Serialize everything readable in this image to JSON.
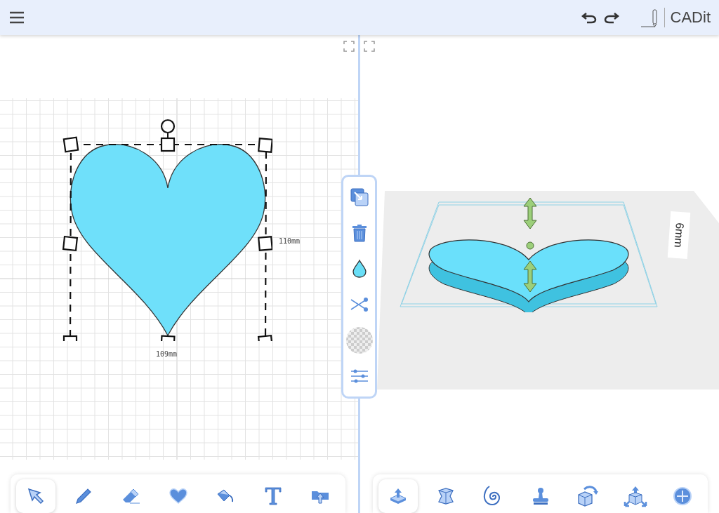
{
  "header": {
    "app_name": "CADit"
  },
  "sketch": {
    "width_label": "109mm",
    "height_label": "110mm"
  },
  "sketch_tools": [
    {
      "kind": "select",
      "selected": true
    },
    {
      "kind": "pencil",
      "selected": false
    },
    {
      "kind": "eraser",
      "selected": false
    },
    {
      "kind": "heart",
      "selected": false
    },
    {
      "kind": "fill",
      "selected": false
    },
    {
      "kind": "text",
      "selected": false
    },
    {
      "kind": "import",
      "selected": false
    }
  ],
  "side_tools": [
    {
      "kind": "duplicate"
    },
    {
      "kind": "delete"
    },
    {
      "kind": "color"
    },
    {
      "kind": "cut"
    },
    {
      "kind": "transparency"
    },
    {
      "kind": "adjust"
    }
  ],
  "model": {
    "thickness_label": "6mm"
  },
  "model_tools": [
    {
      "kind": "extrude",
      "selected": true
    },
    {
      "kind": "pinch",
      "selected": false
    },
    {
      "kind": "spiral",
      "selected": false
    },
    {
      "kind": "stamp",
      "selected": false
    },
    {
      "kind": "rotate",
      "selected": false
    },
    {
      "kind": "explode",
      "selected": false
    },
    {
      "kind": "add",
      "selected": false
    }
  ]
}
